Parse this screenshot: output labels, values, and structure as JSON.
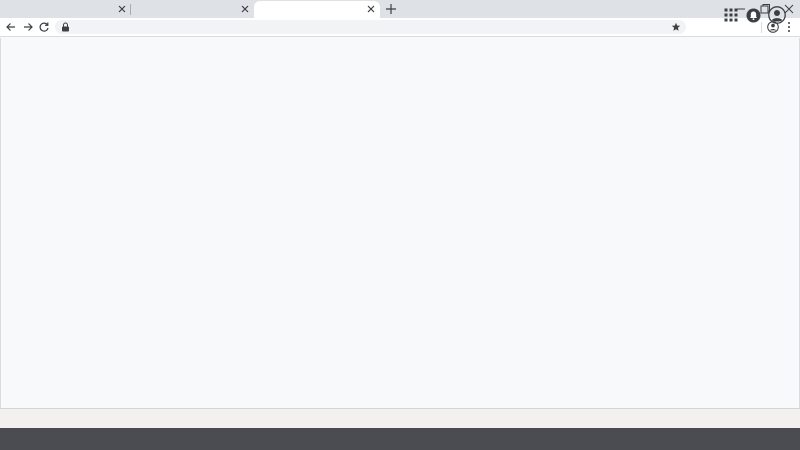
{
  "tabs": [
    {
      "title": "",
      "active": false
    },
    {
      "title": "",
      "active": false
    },
    {
      "title": "",
      "active": true
    }
  ],
  "icons": {
    "tab_close": "close-icon",
    "new_tab": "plus-icon",
    "minimize": "minimize-icon",
    "maximize": "restore-icon",
    "window_close": "close-icon",
    "back": "arrow-left-icon",
    "forward": "arrow-right-icon",
    "reload": "reload-icon",
    "lock": "lock-icon",
    "bookmark": "star-icon",
    "profile": "profile-icon",
    "menu": "kebab-menu-icon",
    "apps": "apps-grid-icon",
    "notifications": "notifications-icon",
    "account": "account-icon"
  },
  "omnibox": {
    "url": ""
  },
  "colors": {
    "tab_strip": "#dee1e6",
    "active_tab": "#ffffff",
    "toolbar": "#ffffff",
    "omnibox": "#f1f3f4",
    "page_bg": "#f8f9fa",
    "status_bar": "#f2f1ef",
    "taskbar": "#4b4c51",
    "icon": "#3c4043"
  }
}
